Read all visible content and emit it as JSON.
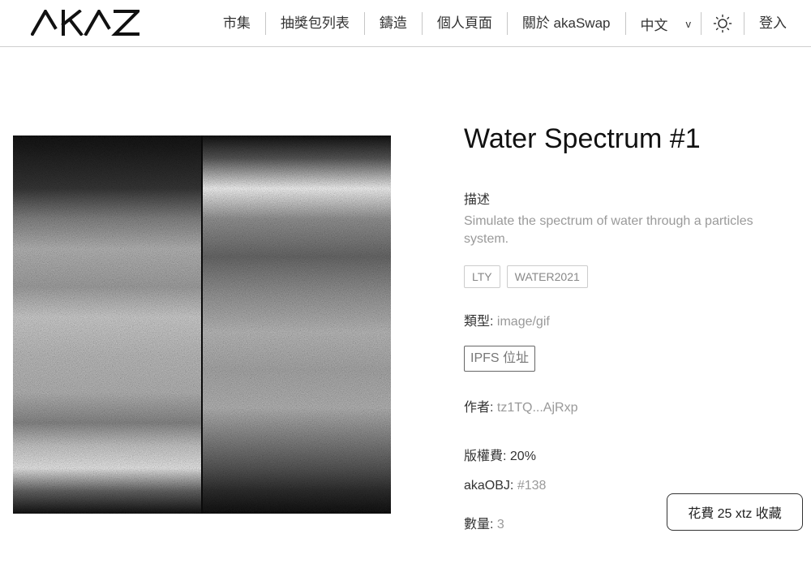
{
  "nav": {
    "items": [
      "市集",
      "抽獎包列表",
      "鑄造",
      "個人頁面",
      "關於 akaSwap"
    ],
    "language": "中文",
    "login": "登入"
  },
  "icons": {
    "logo": "akaswap-logo",
    "language_dropdown": "chevron-down-icon",
    "theme_toggle": "sun-icon"
  },
  "token": {
    "title": "Water Spectrum #1",
    "description_label": "描述",
    "description": "Simulate the spectrum of water through a particles system.",
    "tags": [
      "LTY",
      "WATER2021"
    ],
    "type_label": "類型:",
    "type_value": "image/gif",
    "ipfs_button": "IPFS 位址",
    "author_label": "作者:",
    "author_value": "tz1TQ...AjRxp",
    "royalty_label": "版權費:",
    "royalty_value": "20%",
    "obj_label": "akaOBJ:",
    "obj_value": "#138",
    "amount_label": "數量:",
    "amount_value": "3"
  },
  "collect_button": "花費 25 xtz 收藏"
}
